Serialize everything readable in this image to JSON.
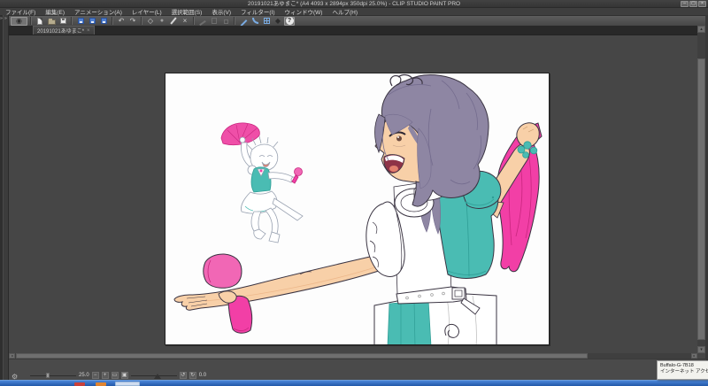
{
  "window": {
    "title": "20191021あゆまこ* (A4 4093 x 2894px 350dpi 25.0%)  - CLIP STUDIO PAINT PRO",
    "minimize": "–",
    "maximize": "▢",
    "close": "×"
  },
  "menu": {
    "items": [
      {
        "label": "ファイル(F)"
      },
      {
        "label": "編集(E)"
      },
      {
        "label": "アニメーション(A)"
      },
      {
        "label": "レイヤー(L)"
      },
      {
        "label": "選択範囲(S)"
      },
      {
        "label": "表示(V)"
      },
      {
        "label": "フィルター(I)"
      },
      {
        "label": "ウィンドウ(W)"
      },
      {
        "label": "ヘルプ(H)"
      }
    ]
  },
  "toolbar": {
    "icons": [
      {
        "name": "clip-studio-eye",
        "glyph": "◉"
      },
      {
        "name": "new-file"
      },
      {
        "name": "open-file"
      },
      {
        "name": "save-file"
      },
      {
        "name": "save-as"
      },
      {
        "name": "export-1"
      },
      {
        "name": "export-2"
      },
      {
        "name": "undo",
        "glyph": "↶"
      },
      {
        "name": "redo",
        "glyph": "↷"
      },
      {
        "name": "clear",
        "glyph": "◇"
      },
      {
        "name": "fill",
        "glyph": "●"
      },
      {
        "name": "brush"
      },
      {
        "name": "scale-rotate",
        "glyph": "×"
      },
      {
        "name": "disabled-1"
      },
      {
        "name": "disabled-2"
      },
      {
        "name": "disabled-3"
      },
      {
        "name": "snap-ruler"
      },
      {
        "name": "snap-special-ruler"
      },
      {
        "name": "snap-grid"
      },
      {
        "name": "material",
        "glyph": "◆"
      },
      {
        "name": "help",
        "glyph": "?"
      }
    ]
  },
  "left_dock": {
    "expand_glyph": "»"
  },
  "tab": {
    "label": "20191021あゆまこ*",
    "close_glyph": "×"
  },
  "scrollbars": {
    "up": "▴",
    "down": "▾",
    "left": "◂",
    "right": "▸"
  },
  "statusbar": {
    "zoom_value": "25.0",
    "zoom_out": "−",
    "zoom_in": "+",
    "fit_glyph": "▭",
    "actual_glyph": "▣",
    "rotate_left": "↺",
    "rotate_right": "↻",
    "rotation_value": "0.0",
    "gear_glyph": "⚙"
  },
  "tooltip": {
    "line1": "Buffalo-G-7B18",
    "line2": "インターネット アクセス"
  },
  "artwork": {
    "description": "Anime illustration: small full-body sketch of idol jumping with pink fan and mini microphone, and large back view of gray-purple-haired idol in teal-and-white costume holding a pink microphone in outstretched hand and a pink cloth in raised hand",
    "colors": {
      "hair": "#8e86a3",
      "skin": "#f8d0a8",
      "teal": "#4abcb3",
      "pink": "#f23fa6",
      "pink_light": "#f167b5",
      "outline": "#3a3442",
      "sketch_line": "#99a2b1",
      "paper": "#fdfdfd"
    }
  }
}
